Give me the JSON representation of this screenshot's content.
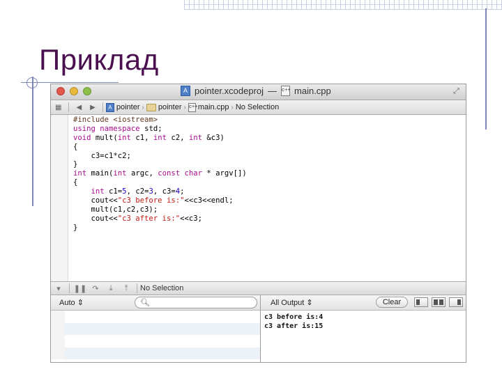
{
  "slide": {
    "title": "Приклад"
  },
  "window": {
    "project_name": "pointer.xcodeproj",
    "title_separator": "—",
    "file_name": "main.cpp",
    "file_icon_text": "c++"
  },
  "jumpbar": {
    "crumbs": [
      "pointer",
      "pointer",
      "main.cpp",
      "No Selection"
    ]
  },
  "editor": {
    "lines": [
      "#include <iostream>",
      "using namespace std;",
      "void mult(int c1, int c2, int &c3)",
      "{",
      "    c3=c1*c2;",
      "}",
      "int main(int argc, const char * argv[])",
      "{",
      "    int c1=5, c2=3, c3=4;",
      "    cout<<\"c3 before is:\"<<c3<<endl;",
      "    mult(c1,c2,c3);",
      "    cout<<\"c3 after is:\"<<c3;",
      "}"
    ]
  },
  "debugbar": {
    "selection_label": "No Selection"
  },
  "variables_panel": {
    "scope_label": "Auto",
    "search_placeholder": ""
  },
  "console_panel": {
    "output_label": "All Output",
    "clear_label": "Clear",
    "output_lines": [
      "c3 before is:4",
      "c3 after is:15"
    ]
  }
}
